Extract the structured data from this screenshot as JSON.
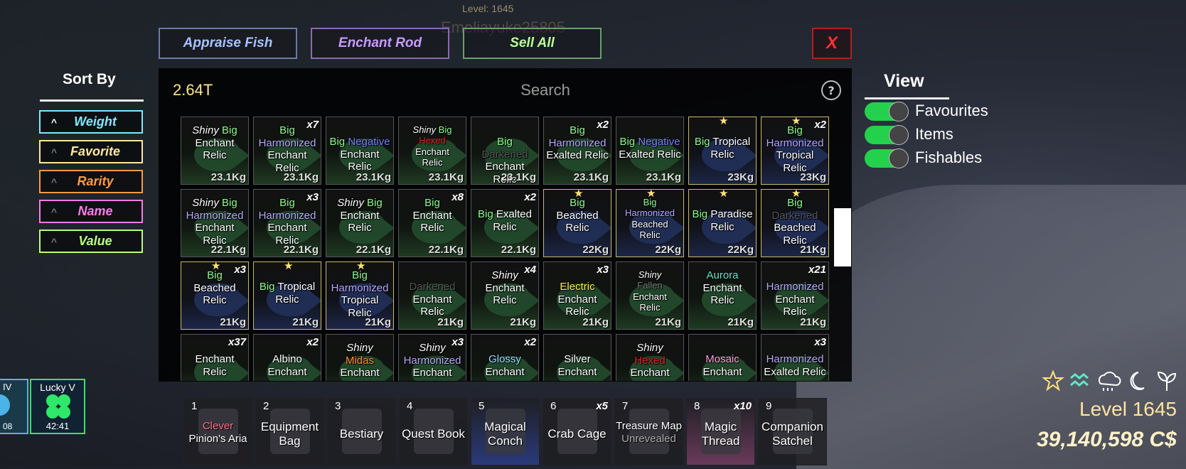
{
  "hud_top": {
    "level_label": "Level: 1645",
    "player_name": "Emeliayuke25805"
  },
  "tabs": {
    "appraise": "Appraise Fish",
    "enchant": "Enchant Rod",
    "sell": "Sell All",
    "close": "X"
  },
  "inventory": {
    "currency": "2.64T",
    "search_placeholder": "Search",
    "help": "?",
    "tiles": [
      {
        "lines": [
          [
            [
              "Shiny ",
              "#fff",
              "i"
            ],
            [
              "Big",
              "#8cff8c",
              ""
            ]
          ],
          [
            [
              "Enchant",
              "#fff",
              ""
            ]
          ],
          [
            [
              "Relic",
              "#fff",
              ""
            ]
          ]
        ],
        "weight": "23.1Kg",
        "count": "",
        "fav": false,
        "bg": "green"
      },
      {
        "lines": [
          [
            [
              "Big",
              "#8cff8c",
              ""
            ]
          ],
          [
            [
              "Harmonized",
              "#b8a8ff",
              ""
            ]
          ],
          [
            [
              "Enchant Relic",
              "#fff",
              ""
            ]
          ]
        ],
        "weight": "23.1Kg",
        "count": "x7",
        "fav": false,
        "bg": "green"
      },
      {
        "lines": [
          [
            [
              "Big ",
              "#8cff8c",
              ""
            ],
            [
              "Negative",
              "#7a7aff",
              ""
            ]
          ],
          [
            [
              "Enchant Relic",
              "#fff",
              ""
            ]
          ]
        ],
        "weight": "23.1Kg",
        "count": "",
        "fav": false,
        "bg": "green"
      },
      {
        "lines": [
          [
            [
              "Shiny ",
              "#fff",
              "i"
            ],
            [
              "Big",
              "#8cff8c",
              ""
            ]
          ],
          [
            [
              "Hexed",
              "#e02020",
              ""
            ]
          ],
          [
            [
              "Enchant",
              "#fff",
              ""
            ]
          ],
          [
            [
              "Relic",
              "#fff",
              ""
            ]
          ]
        ],
        "weight": "23.1Kg",
        "count": "",
        "fav": false,
        "bg": "green"
      },
      {
        "lines": [
          [
            [
              "Big ",
              "#8cff8c",
              ""
            ],
            [
              "Darkened",
              "#555",
              ""
            ]
          ],
          [
            [
              "Enchant Relic",
              "#fff",
              ""
            ]
          ]
        ],
        "weight": "23.1Kg",
        "count": "",
        "fav": false,
        "bg": "green"
      },
      {
        "lines": [
          [
            [
              "Big",
              "#8cff8c",
              ""
            ]
          ],
          [
            [
              "Harmonized",
              "#b8a8ff",
              ""
            ]
          ],
          [
            [
              "Exalted Relic",
              "#fff",
              ""
            ]
          ]
        ],
        "weight": "23.1Kg",
        "count": "x2",
        "fav": false,
        "bg": "green"
      },
      {
        "lines": [
          [
            [
              "Big ",
              "#8cff8c",
              ""
            ],
            [
              "Negative",
              "#7a7aff",
              ""
            ]
          ],
          [
            [
              "Exalted Relic",
              "#fff",
              ""
            ]
          ]
        ],
        "weight": "23.1Kg",
        "count": "",
        "fav": false,
        "bg": "green"
      },
      {
        "lines": [
          [
            [
              "Big ",
              "#8cff8c",
              ""
            ],
            [
              "Tropical",
              "#fff",
              ""
            ]
          ],
          [
            [
              "Relic",
              "#fff",
              ""
            ]
          ]
        ],
        "weight": "23Kg",
        "count": "",
        "fav": true,
        "bg": "blue"
      },
      {
        "lines": [
          [
            [
              "Big",
              "#8cff8c",
              ""
            ]
          ],
          [
            [
              "Harmonized",
              "#b8a8ff",
              ""
            ]
          ],
          [
            [
              "Tropical Relic",
              "#fff",
              ""
            ]
          ]
        ],
        "weight": "23Kg",
        "count": "x2",
        "fav": true,
        "bg": "blue"
      },
      {
        "lines": [
          [
            [
              "Shiny ",
              "#fff",
              "i"
            ],
            [
              "Big",
              "#8cff8c",
              ""
            ]
          ],
          [
            [
              "Harmonized",
              "#b8a8ff",
              ""
            ]
          ],
          [
            [
              "Enchant Relic",
              "#fff",
              ""
            ]
          ]
        ],
        "weight": "22.1Kg",
        "count": "",
        "fav": false,
        "bg": "green"
      },
      {
        "lines": [
          [
            [
              "Big",
              "#8cff8c",
              ""
            ]
          ],
          [
            [
              "Harmonized",
              "#b8a8ff",
              ""
            ]
          ],
          [
            [
              "Enchant Relic",
              "#fff",
              ""
            ]
          ]
        ],
        "weight": "22.1Kg",
        "count": "x3",
        "fav": false,
        "bg": "green"
      },
      {
        "lines": [
          [
            [
              "Shiny ",
              "#fff",
              "i"
            ],
            [
              "Big",
              "#8cff8c",
              ""
            ]
          ],
          [
            [
              "Enchant",
              "#fff",
              ""
            ]
          ],
          [
            [
              "Relic",
              "#fff",
              ""
            ]
          ]
        ],
        "weight": "22.1Kg",
        "count": "",
        "fav": false,
        "bg": "green"
      },
      {
        "lines": [
          [
            [
              "Big",
              "#8cff8c",
              ""
            ]
          ],
          [
            [
              "Enchant",
              "#fff",
              ""
            ]
          ],
          [
            [
              "Relic",
              "#fff",
              ""
            ]
          ]
        ],
        "weight": "22.1Kg",
        "count": "x8",
        "fav": false,
        "bg": "green"
      },
      {
        "lines": [
          [
            [
              "Big ",
              "#8cff8c",
              ""
            ],
            [
              "Exalted",
              "#fff",
              ""
            ]
          ],
          [
            [
              "Relic",
              "#fff",
              ""
            ]
          ]
        ],
        "weight": "22.1Kg",
        "count": "x2",
        "fav": false,
        "bg": "green"
      },
      {
        "lines": [
          [
            [
              "Big",
              "#8cff8c",
              ""
            ]
          ],
          [
            [
              "Beached",
              "#fff",
              ""
            ]
          ],
          [
            [
              "Relic",
              "#fff",
              ""
            ]
          ]
        ],
        "weight": "22Kg",
        "count": "",
        "fav": true,
        "bg": "blue"
      },
      {
        "lines": [
          [
            [
              "Big",
              "#8cff8c",
              ""
            ]
          ],
          [
            [
              "Harmonized",
              "#b8a8ff",
              ""
            ]
          ],
          [
            [
              "Beached",
              "#fff",
              ""
            ]
          ],
          [
            [
              "Relic",
              "#fff",
              ""
            ]
          ]
        ],
        "weight": "22Kg",
        "count": "",
        "fav": true,
        "bg": "blue"
      },
      {
        "lines": [
          [
            [
              "Big ",
              "#8cff8c",
              ""
            ],
            [
              "Paradise",
              "#fff",
              ""
            ]
          ],
          [
            [
              "Relic",
              "#fff",
              ""
            ]
          ]
        ],
        "weight": "22Kg",
        "count": "",
        "fav": true,
        "bg": "blue"
      },
      {
        "lines": [
          [
            [
              "Big ",
              "#8cff8c",
              ""
            ],
            [
              "Darkened",
              "#555",
              ""
            ]
          ],
          [
            [
              "Beached",
              "#fff",
              ""
            ]
          ],
          [
            [
              "Relic",
              "#fff",
              ""
            ]
          ]
        ],
        "weight": "21Kg",
        "count": "",
        "fav": true,
        "bg": "blue"
      },
      {
        "lines": [
          [
            [
              "Big",
              "#8cff8c",
              ""
            ]
          ],
          [
            [
              "Beached",
              "#fff",
              ""
            ]
          ],
          [
            [
              "Relic",
              "#fff",
              ""
            ]
          ]
        ],
        "weight": "21Kg",
        "count": "x3",
        "fav": true,
        "bg": "blue"
      },
      {
        "lines": [
          [
            [
              "Big ",
              "#8cff8c",
              ""
            ],
            [
              "Tropical",
              "#fff",
              ""
            ]
          ],
          [
            [
              "Relic",
              "#fff",
              ""
            ]
          ]
        ],
        "weight": "21Kg",
        "count": "",
        "fav": true,
        "bg": "blue"
      },
      {
        "lines": [
          [
            [
              "Big",
              "#8cff8c",
              ""
            ]
          ],
          [
            [
              "Harmonized",
              "#b8a8ff",
              ""
            ]
          ],
          [
            [
              "Tropical Relic",
              "#fff",
              ""
            ]
          ]
        ],
        "weight": "21Kg",
        "count": "",
        "fav": true,
        "bg": "blue"
      },
      {
        "lines": [
          [
            [
              "Darkened",
              "#555",
              ""
            ]
          ],
          [
            [
              "Enchant Relic",
              "#fff",
              ""
            ]
          ]
        ],
        "weight": "21Kg",
        "count": "",
        "fav": false,
        "bg": "green"
      },
      {
        "lines": [
          [
            [
              "Shiny",
              "#fff",
              "i"
            ]
          ],
          [
            [
              "Enchant",
              "#fff",
              ""
            ]
          ],
          [
            [
              "Relic",
              "#fff",
              ""
            ]
          ]
        ],
        "weight": "21Kg",
        "count": "x4",
        "fav": false,
        "bg": "green"
      },
      {
        "lines": [
          [
            [
              "Electric",
              "#ffee40",
              ""
            ]
          ],
          [
            [
              "Enchant Relic",
              "#fff",
              ""
            ]
          ]
        ],
        "weight": "21Kg",
        "count": "x3",
        "fav": false,
        "bg": "green"
      },
      {
        "lines": [
          [
            [
              "Shiny",
              "#fff",
              "i"
            ]
          ],
          [
            [
              "Fallen",
              "#777",
              ""
            ]
          ],
          [
            [
              "Enchant",
              "#fff",
              ""
            ]
          ],
          [
            [
              "Relic",
              "#fff",
              ""
            ]
          ]
        ],
        "weight": "21Kg",
        "count": "",
        "fav": false,
        "bg": "green"
      },
      {
        "lines": [
          [
            [
              "Aurora",
              "#5fe8c8",
              ""
            ]
          ],
          [
            [
              "Enchant",
              "#fff",
              ""
            ]
          ],
          [
            [
              "Relic",
              "#fff",
              ""
            ]
          ]
        ],
        "weight": "21Kg",
        "count": "",
        "fav": false,
        "bg": "green"
      },
      {
        "lines": [
          [
            [
              "Harmonized",
              "#b8a8ff",
              ""
            ]
          ],
          [
            [
              "Enchant Relic",
              "#fff",
              ""
            ]
          ]
        ],
        "weight": "21Kg",
        "count": "x21",
        "fav": false,
        "bg": "green"
      },
      {
        "lines": [
          [
            [
              "Enchant",
              "#fff",
              ""
            ]
          ],
          [
            [
              "Relic",
              "#fff",
              ""
            ]
          ]
        ],
        "weight": "",
        "count": "x37",
        "fav": false,
        "bg": "green"
      },
      {
        "lines": [
          [
            [
              "Albino",
              "#fff",
              ""
            ]
          ],
          [
            [
              "Enchant",
              "#fff",
              ""
            ]
          ]
        ],
        "weight": "",
        "count": "x2",
        "fav": false,
        "bg": "green"
      },
      {
        "lines": [
          [
            [
              "Shiny",
              "#fff",
              "i"
            ]
          ],
          [
            [
              "Midas",
              "#ff8c30",
              ""
            ]
          ],
          [
            [
              "Enchant",
              "#fff",
              ""
            ]
          ]
        ],
        "weight": "",
        "count": "",
        "fav": false,
        "bg": "green"
      },
      {
        "lines": [
          [
            [
              "Shiny",
              "#fff",
              "i"
            ]
          ],
          [
            [
              "Harmonized",
              "#b8a8ff",
              ""
            ]
          ],
          [
            [
              "Enchant Relic",
              "#fff",
              ""
            ]
          ]
        ],
        "weight": "",
        "count": "x3",
        "fav": false,
        "bg": "green"
      },
      {
        "lines": [
          [
            [
              "Glossy",
              "#9ad8ff",
              ""
            ]
          ],
          [
            [
              "Enchant",
              "#fff",
              ""
            ]
          ]
        ],
        "weight": "",
        "count": "x2",
        "fav": false,
        "bg": "green"
      },
      {
        "lines": [
          [
            [
              "Silver",
              "#fff",
              ""
            ]
          ],
          [
            [
              "Enchant",
              "#fff",
              ""
            ]
          ]
        ],
        "weight": "",
        "count": "",
        "fav": false,
        "bg": "green"
      },
      {
        "lines": [
          [
            [
              "Shiny",
              "#fff",
              "i"
            ]
          ],
          [
            [
              "Hexed",
              "#e02020",
              ""
            ]
          ],
          [
            [
              "Enchant",
              "#fff",
              ""
            ]
          ]
        ],
        "weight": "",
        "count": "",
        "fav": false,
        "bg": "green"
      },
      {
        "lines": [
          [
            [
              "Mosaic",
              "#ff9ad8",
              ""
            ]
          ],
          [
            [
              "Enchant",
              "#fff",
              ""
            ]
          ]
        ],
        "weight": "",
        "count": "",
        "fav": false,
        "bg": "green"
      },
      {
        "lines": [
          [
            [
              "Harmonized",
              "#b8a8ff",
              ""
            ]
          ],
          [
            [
              "Exalted Relic",
              "#fff",
              ""
            ]
          ]
        ],
        "weight": "",
        "count": "x3",
        "fav": false,
        "bg": "green"
      }
    ]
  },
  "sort": {
    "title": "Sort By",
    "options": [
      {
        "label": "Weight",
        "color": "#7ee8ff",
        "active": true
      },
      {
        "label": "Favorite",
        "color": "#ffe79a",
        "active": false
      },
      {
        "label": "Rarity",
        "color": "#ff9a40",
        "active": false
      },
      {
        "label": "Name",
        "color": "#ff7ae8",
        "active": false
      },
      {
        "label": "Value",
        "color": "#b8ff7a",
        "active": false
      }
    ]
  },
  "view": {
    "title": "View",
    "toggles": [
      {
        "label": "Favourites",
        "on": true
      },
      {
        "label": "Items",
        "on": true
      },
      {
        "label": "Fishables",
        "on": true
      }
    ]
  },
  "hotbar": [
    {
      "num": "1",
      "label": "Clever",
      "label_color": "#ff6a8a",
      "label2": "Pinion's Aria",
      "count": ""
    },
    {
      "num": "2",
      "label": "Equipment",
      "label_color": "#fff",
      "label2": "Bag",
      "count": ""
    },
    {
      "num": "3",
      "label": "Bestiary",
      "label_color": "#fff",
      "label2": "",
      "count": ""
    },
    {
      "num": "4",
      "label": "Quest Book",
      "label_color": "#fff",
      "label2": "",
      "count": ""
    },
    {
      "num": "5",
      "label": "Magical",
      "label_color": "#fff",
      "label2": "Conch",
      "count": ""
    },
    {
      "num": "6",
      "label": "Crab Cage",
      "label_color": "#fff",
      "label2": "",
      "count": "x5"
    },
    {
      "num": "7",
      "label": "Treasure Map",
      "label_color": "#fff",
      "label2": "Unrevealed",
      "count": ""
    },
    {
      "num": "8",
      "label": "Magic",
      "label_color": "#fff",
      "label2": "Thread",
      "count": "x10"
    },
    {
      "num": "9",
      "label": "Companion",
      "label_color": "#fff",
      "label2": "Satchel",
      "count": ""
    }
  ],
  "boosts": [
    {
      "title": "IV",
      "timer": "08"
    },
    {
      "title": "Lucky V",
      "timer": "42:41"
    }
  ],
  "status": {
    "level": "Level 1645",
    "money": "39,140,598 C$",
    "weather_icons": [
      "star-icon",
      "wind-icon",
      "cloud-icon",
      "moon-icon",
      "sprout-icon"
    ]
  }
}
